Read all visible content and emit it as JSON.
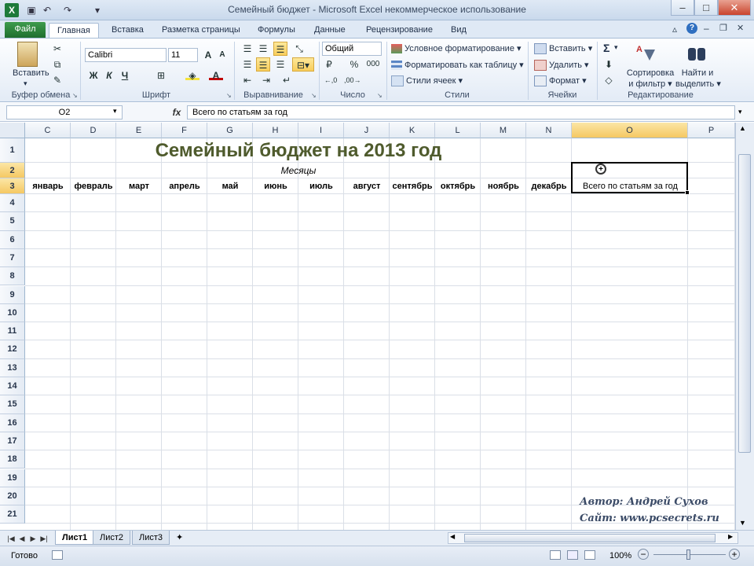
{
  "window": {
    "title": "Семейный бюджет - Microsoft Excel некоммерческое использование",
    "app_icon": "X"
  },
  "tabs": [
    "Файл",
    "Главная",
    "Вставка",
    "Разметка страницы",
    "Формулы",
    "Данные",
    "Рецензирование",
    "Вид"
  ],
  "ribbon": {
    "clipboard": {
      "paste": "Вставить",
      "label": "Буфер обмена"
    },
    "font": {
      "name": "Calibri",
      "size": "11",
      "bold": "Ж",
      "italic": "К",
      "underline": "Ч",
      "label": "Шрифт"
    },
    "alignment": {
      "label": "Выравнивание"
    },
    "number": {
      "format": "Общий",
      "percent": "%",
      "thousands": "000",
      "label": "Число"
    },
    "styles": {
      "conditional": "Условное форматирование",
      "as_table": "Форматировать как таблицу",
      "cell_styles": "Стили ячеек",
      "label": "Стили"
    },
    "cells": {
      "insert": "Вставить",
      "delete": "Удалить",
      "format": "Формат",
      "label": "Ячейки"
    },
    "editing": {
      "sigma": "Σ",
      "sort_line1": "Сортировка",
      "sort_line2": "и фильтр",
      "find_line1": "Найти и",
      "find_line2": "выделить",
      "label": "Редактирование"
    }
  },
  "formula_bar": {
    "name_box": "O2",
    "fx": "fx",
    "content": "Всего по статьям за год"
  },
  "grid": {
    "columns": [
      "C",
      "D",
      "E",
      "F",
      "G",
      "H",
      "I",
      "J",
      "K",
      "L",
      "M",
      "N",
      "O",
      "P"
    ],
    "rows": [
      "1",
      "2",
      "3",
      "4",
      "5",
      "6",
      "7",
      "8",
      "9",
      "10",
      "11",
      "12",
      "13",
      "14",
      "15",
      "16",
      "17",
      "18",
      "19",
      "20",
      "21"
    ],
    "title": "Семейный бюджет на 2013 год",
    "months_label": "Месяцы",
    "months": [
      "январь",
      "февраль",
      "март",
      "апрель",
      "май",
      "июнь",
      "июль",
      "август",
      "сентябрь",
      "октябрь",
      "ноябрь",
      "декабрь"
    ],
    "total_header": "Всего по статьям за год",
    "selected_column": "O"
  },
  "author": {
    "line1": "Автор: Андрей Сухов",
    "line2": "Сайт: www.pcsecrets.ru"
  },
  "sheets": [
    "Лист1",
    "Лист2",
    "Лист3"
  ],
  "status": {
    "ready": "Готово",
    "zoom": "100%"
  }
}
